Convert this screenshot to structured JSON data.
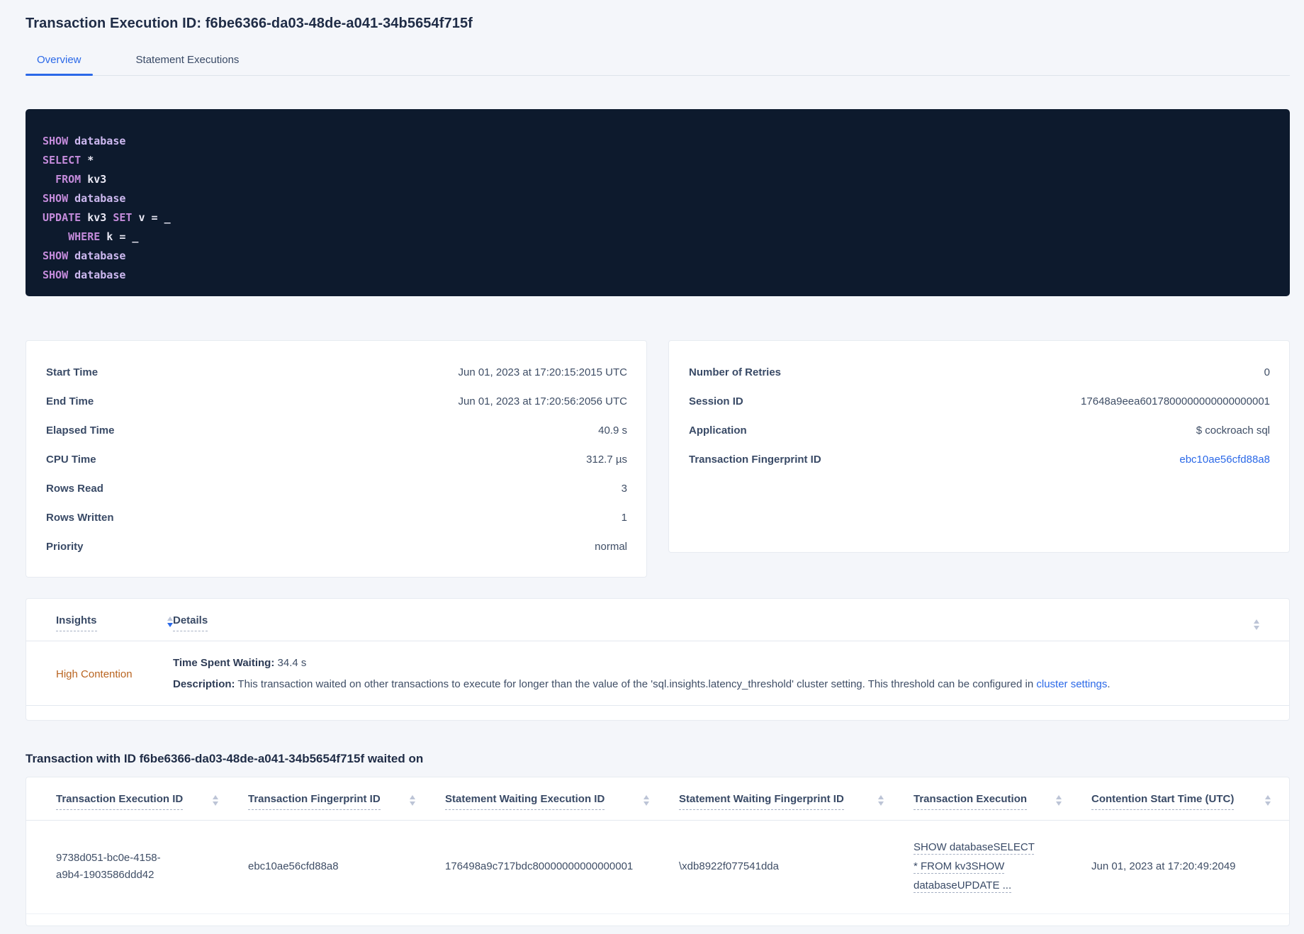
{
  "page": {
    "title": "Transaction Execution ID: f6be6366-da03-48de-a041-34b5654f715f"
  },
  "tabs": {
    "overview": "Overview",
    "statement_executions": "Statement Executions"
  },
  "sql": {
    "lines": [
      [
        "SHOW",
        " database"
      ],
      [
        "SELECT",
        " *"
      ],
      [
        "  ",
        "FROM",
        " kv3"
      ],
      [
        "SHOW",
        " database"
      ],
      [
        "UPDATE",
        " kv3 ",
        "SET",
        " v = _"
      ],
      [
        "    ",
        "WHERE",
        " k = _"
      ],
      [
        "SHOW",
        " database"
      ],
      [
        "SHOW",
        " database"
      ]
    ]
  },
  "summary": {
    "left": [
      {
        "label": "Start Time",
        "value": "Jun 01, 2023 at 17:20:15:2015 UTC"
      },
      {
        "label": "End Time",
        "value": "Jun 01, 2023 at 17:20:56:2056 UTC"
      },
      {
        "label": "Elapsed Time",
        "value": "40.9 s"
      },
      {
        "label": "CPU Time",
        "value": "312.7 µs"
      },
      {
        "label": "Rows Read",
        "value": "3"
      },
      {
        "label": "Rows Written",
        "value": "1"
      },
      {
        "label": "Priority",
        "value": "normal"
      }
    ],
    "right": [
      {
        "label": "Number of Retries",
        "value": "0"
      },
      {
        "label": "Session ID",
        "value": "17648a9eea6017800000000000000001"
      },
      {
        "label": "Application",
        "value": "$ cockroach sql"
      },
      {
        "label": "Transaction Fingerprint ID",
        "value": "ebc10ae56cfd88a8"
      }
    ]
  },
  "insights": {
    "header": {
      "insights": "Insights",
      "details": "Details"
    },
    "row": {
      "insight": "High Contention",
      "waiting_label": "Time Spent Waiting:",
      "waiting_value": " 34.4 s",
      "description_label": "Description:",
      "description_text": " This transaction waited on other transactions to execute for longer than the value of the 'sql.insights.latency_threshold' cluster setting. This threshold can be configured in ",
      "description_link": "cluster settings",
      "description_end": "."
    }
  },
  "waited_on": {
    "title": "Transaction with ID f6be6366-da03-48de-a041-34b5654f715f waited on",
    "columns": [
      "Transaction Execution ID",
      "Transaction Fingerprint ID",
      "Statement Waiting Execution ID",
      "Statement Waiting Fingerprint ID",
      "Transaction Execution",
      "Contention Start Time (UTC)"
    ],
    "row": {
      "transaction_execution_id": "9738d051-bc0e-4158-a9b4-1903586ddd42",
      "transaction_fingerprint_id": "ebc10ae56cfd88a8",
      "statement_waiting_execution_id": "176498a9c717bdc80000000000000001",
      "statement_waiting_fingerprint_id": "\\xdb8922f077541dda",
      "transaction_execution": "SHOW databaseSELECT * FROM kv3SHOW databaseUPDATE ...",
      "contention_start_time": "Jun 01, 2023 at 17:20:49:2049"
    }
  },
  "colors": {
    "accent_blue": "#2b69e8",
    "insight_orange": "#b96420",
    "code_background": "#0d1a2d"
  }
}
